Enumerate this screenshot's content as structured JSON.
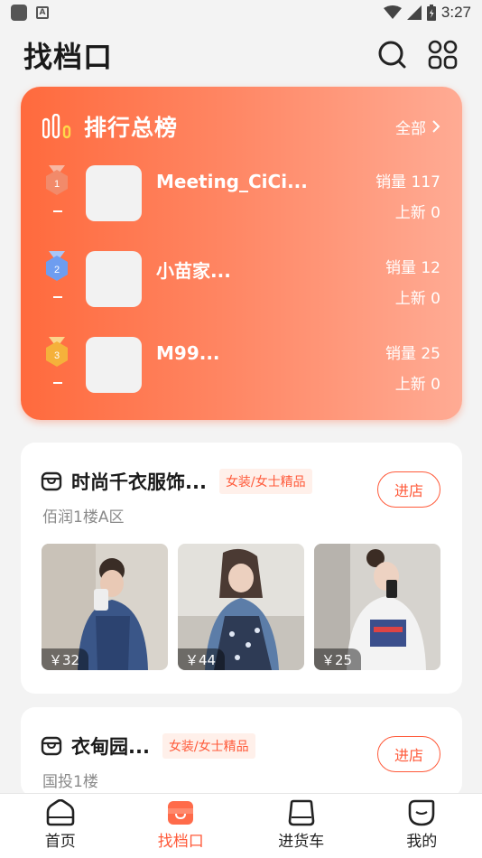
{
  "status_bar": {
    "time": "3:27",
    "app_badge": "A"
  },
  "header": {
    "title": "找档口"
  },
  "ranking": {
    "title": "排行总榜",
    "all_label": "全部",
    "items": [
      {
        "rank": "1",
        "name": "Meeting_CiCi...",
        "sales": "销量 117",
        "new": "上新 0",
        "medal_color": "#f28a6a"
      },
      {
        "rank": "2",
        "name": "小苗家...",
        "sales": "销量 12",
        "new": "上新 0",
        "medal_color": "#6e9df0"
      },
      {
        "rank": "3",
        "name": "M99...",
        "sales": "销量 25",
        "new": "上新 0",
        "medal_color": "#f5b13b"
      }
    ]
  },
  "stores": [
    {
      "name": "时尚千衣服饰...",
      "tag": "女装/女士精品",
      "location": "佰润1楼A区",
      "enter_label": "进店",
      "products": [
        {
          "price": "￥32"
        },
        {
          "price": "￥44"
        },
        {
          "price": "￥25"
        }
      ]
    },
    {
      "name": "衣甸园...",
      "tag": "女装/女士精品",
      "location": "国投1楼",
      "enter_label": "进店"
    }
  ],
  "tabs": [
    {
      "label": "首页",
      "icon": "home-icon"
    },
    {
      "label": "找档口",
      "icon": "store-icon",
      "active": true
    },
    {
      "label": "进货车",
      "icon": "cart-icon"
    },
    {
      "label": "我的",
      "icon": "profile-icon"
    }
  ],
  "colors": {
    "accent": "#ff5a3a",
    "card_gradient_start": "#ff6a3d",
    "card_gradient_end": "#ffab94"
  }
}
